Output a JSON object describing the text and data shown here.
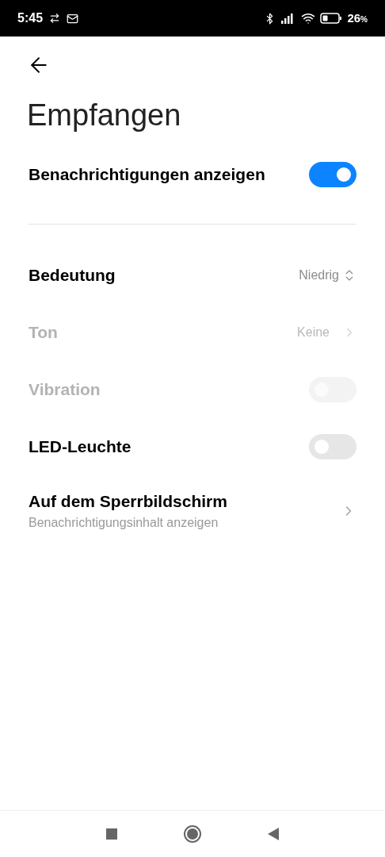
{
  "status_bar": {
    "time": "5:45",
    "battery_level": "26",
    "battery_unit": "%"
  },
  "title": "Empfangen",
  "main_toggle": {
    "label": "Benachrichtigungen anzeigen",
    "on": true
  },
  "rows": [
    {
      "kind": "select",
      "label": "Bedeutung",
      "value": "Niedrig",
      "disabled": false
    },
    {
      "kind": "link",
      "label": "Ton",
      "value": "Keine",
      "disabled": true
    },
    {
      "kind": "toggle",
      "label": "Vibration",
      "on": false,
      "disabled": true
    },
    {
      "kind": "toggle",
      "label": "LED-Leuchte",
      "on": false,
      "disabled": false
    },
    {
      "kind": "nav",
      "label": "Auf dem Sperrbildschirm",
      "subtitle": "Benachrichtigungsinhalt anzeigen",
      "disabled": false
    }
  ]
}
